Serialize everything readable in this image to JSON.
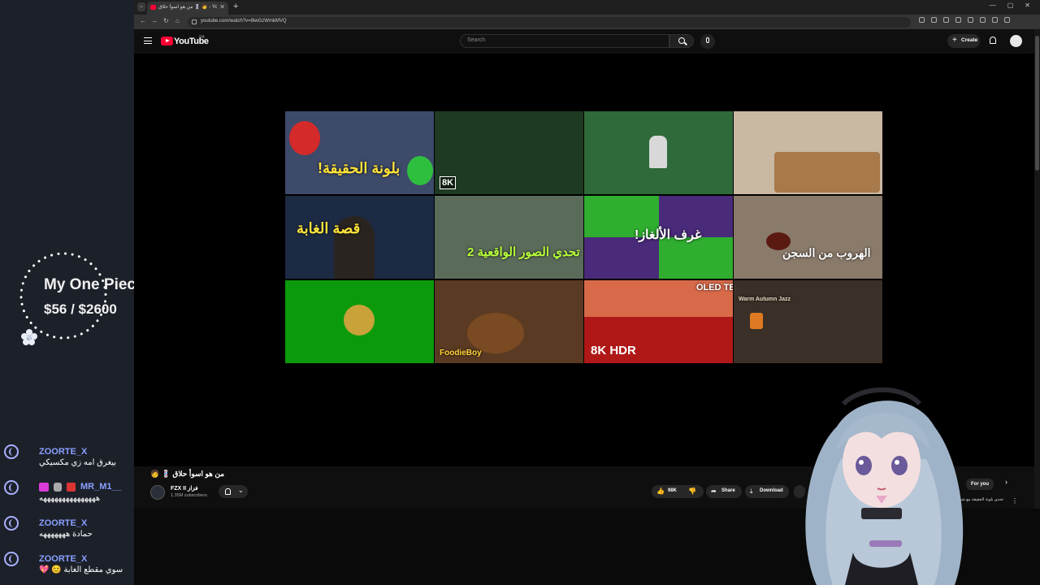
{
  "overlay": {
    "goal_title": "My One Piece",
    "goal_progress": "$56 / $2600",
    "chat": [
      {
        "user": "ZOORTE_X",
        "text": "بيغرق امه زي مكسيكي"
      },
      {
        "user": "MR_M1__",
        "text": "هههههههههههههههه"
      },
      {
        "user": "ZOORTE_X",
        "text": "حمادة هههههههه"
      },
      {
        "user": "ZOORTE_X",
        "text": "سوي مقطع الغابة 😊 💖"
      }
    ]
  },
  "browser": {
    "tab_title": "من هو اسوأ حلاق 💈 🧑 - YouTube",
    "url": "youtube.com/watch?v=6lwGzWmkMVQ",
    "tab_menu": "⌄",
    "new_tab": "+",
    "tab_close": "✕",
    "window_controls": [
      "—",
      "▢",
      "✕"
    ],
    "nav": {
      "back": "←",
      "forward": "→",
      "reload": "↻",
      "home": "⌂"
    }
  },
  "youtube": {
    "logo_text": "YouTube",
    "region": "SA",
    "search_placeholder": "Search",
    "create_plus": "+",
    "create_label": "Create",
    "video_title": "من هو اسوأ حلاق 💈 🧑",
    "channel_name": "FZX II فزاز",
    "channel_subs": "1.35M subscribers",
    "likes": "98K",
    "share": "Share",
    "download": "Download",
    "chips": {
      "related": "ted",
      "for_you": "For you",
      "next": "›"
    },
    "rec_title": "تحدي بلونة الحقيقة مع شباب فالكونز",
    "rec_more": "⋮",
    "sub_chevron": "⌄"
  },
  "thumbnails": [
    {
      "bg": "#3d4a6a",
      "text": "بلونة الحقيقة!",
      "badge": ""
    },
    {
      "bg": "#1f3a22",
      "text": "",
      "badge": "8K"
    },
    {
      "bg": "#2f6a3a",
      "text": "",
      "badge": ""
    },
    {
      "bg": "#c9b8a2",
      "text": "",
      "badge": ""
    },
    {
      "bg": "#1c2a44",
      "text": "قصة الغابة",
      "badge": ""
    },
    {
      "bg": "#5a6b5a",
      "text": "تحدي الصور الواقعية 2",
      "badge": ""
    },
    {
      "bg": "#4a2a7a",
      "text": "غرف الألغاز!",
      "badge": ""
    },
    {
      "bg": "#8a7a6a",
      "text": "الهروب من السجن",
      "badge": ""
    },
    {
      "bg": "#0b9a0b",
      "text": "",
      "badge": ""
    },
    {
      "bg": "#5a3a22",
      "text": "FoodieBoy",
      "badge": ""
    },
    {
      "bg": "#b01818",
      "text": "OLED TEST",
      "badge": "8K HDR"
    },
    {
      "bg": "#3a3028",
      "text": "Warm Autumn Jazz",
      "badge": ""
    }
  ],
  "colors": {
    "accent": "#ff0033",
    "chat_user": "#8aa0ff",
    "panel": "#1c2029"
  }
}
